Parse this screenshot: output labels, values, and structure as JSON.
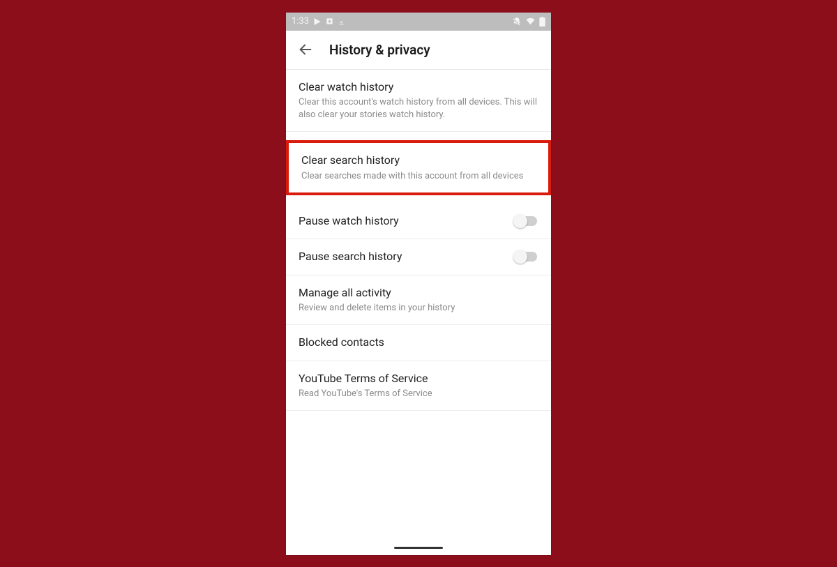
{
  "statusBar": {
    "time": "1:33"
  },
  "header": {
    "title": "History & privacy"
  },
  "items": [
    {
      "title": "Clear watch history",
      "subtitle": "Clear this account's watch history from all devices. This will also clear your stories watch history."
    },
    {
      "title": "Clear search history",
      "subtitle": "Clear searches made with this account from all devices"
    },
    {
      "title": "Pause watch history"
    },
    {
      "title": "Pause search history"
    },
    {
      "title": "Manage all activity",
      "subtitle": "Review and delete items in your history"
    },
    {
      "title": "Blocked contacts"
    },
    {
      "title": "YouTube Terms of Service",
      "subtitle": "Read YouTube's Terms of Service"
    }
  ]
}
